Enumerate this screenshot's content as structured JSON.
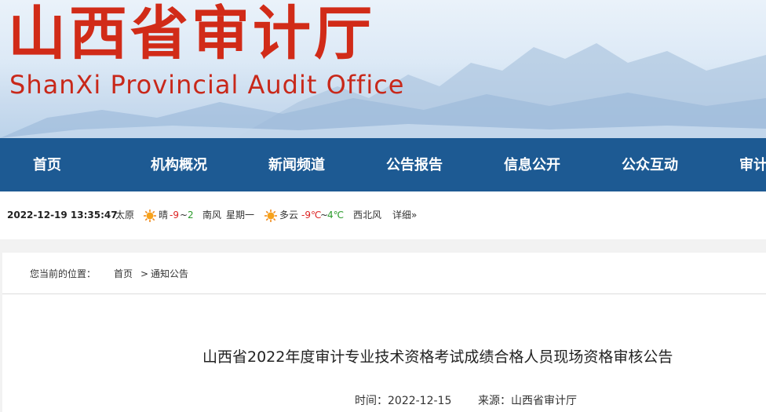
{
  "banner": {
    "title": "山西省审计厅",
    "subtitle": "ShanXi Provincial Audit Office"
  },
  "nav": {
    "items": [
      "首页",
      "机构概况",
      "新闻频道",
      "公告报告",
      "信息公开",
      "公众互动",
      "审计"
    ]
  },
  "weather": {
    "datetime": "2022-12-19 13:35:47",
    "city": "太原",
    "today": {
      "icon": "sun-icon",
      "condition": "晴",
      "temp_low": "-9",
      "sep": "~",
      "temp_high": "2",
      "wind": "南风",
      "weekday": "星期一"
    },
    "tomorrow": {
      "icon": "sun-icon",
      "condition": "多云",
      "temp_low": "-9℃",
      "sep": "~",
      "temp_high": "4℃",
      "wind": "西北风"
    },
    "details_link": "详细»"
  },
  "breadcrumb": {
    "label": "您当前的位置：",
    "home": "首页",
    "sep": ">",
    "current": "通知公告"
  },
  "article": {
    "title": "山西省2022年度审计专业技术资格考试成绩合格人员现场资格审核公告",
    "time": "时间：2022-12-15",
    "source": "来源：山西省审计厅"
  },
  "colors": {
    "nav_bg": "#1d5a93",
    "title_red": "#d12b18"
  }
}
